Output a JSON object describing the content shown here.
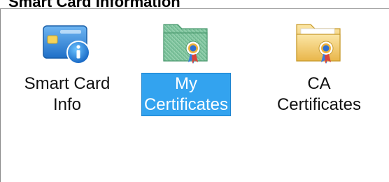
{
  "group": {
    "heading": "Smart Card Information"
  },
  "items": [
    {
      "label_line1": "Smart Card",
      "label_line2": "Info",
      "icon": "smart-card-info-icon",
      "selected": false
    },
    {
      "label_line1": "My",
      "label_line2": "Certificates",
      "icon": "green-certificate-folder-icon",
      "selected": true
    },
    {
      "label_line1": "CA",
      "label_line2": "Certificates",
      "icon": "yellow-certificate-folder-icon",
      "selected": false
    }
  ],
  "colors": {
    "selection": "#33a3ef",
    "green_folder": "#8ecda8",
    "yellow_folder": "#f5d27a",
    "card_blue": "#2b7fd4"
  }
}
